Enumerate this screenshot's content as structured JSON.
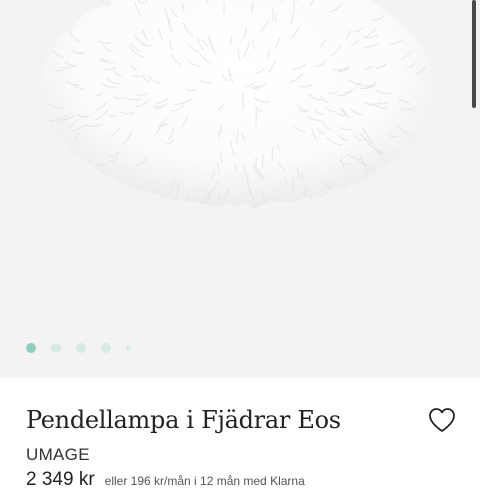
{
  "product": {
    "title": "Pendellampa i Fjädrar Eos",
    "brand": "UMAGE",
    "price": "2 349 kr",
    "klarna_text": "eller 196 kr/mån i 12 mån med Klarna"
  },
  "gallery": {
    "image_count": 5,
    "active_index": 0,
    "background_color": "#f5f3f1",
    "dot_active_color": "#8fcdbf",
    "dot_inactive_color": "#d4ebe6"
  },
  "icons": {
    "favorite": "heart-outline-icon"
  }
}
